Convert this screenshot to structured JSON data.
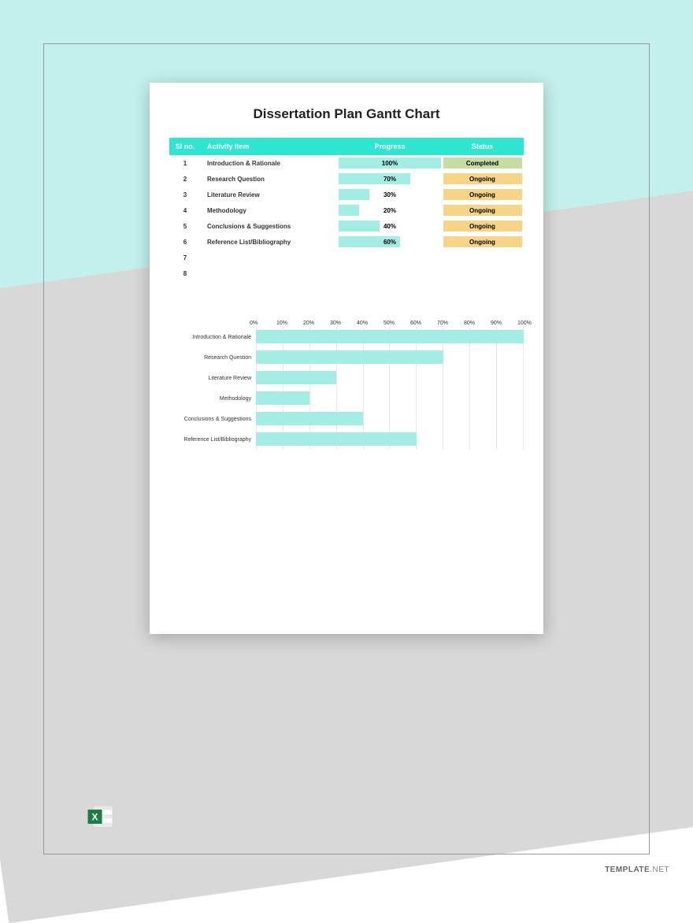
{
  "title": "Dissertation Plan Gantt Chart",
  "headers": {
    "sl": "Sl no.",
    "activity": "Activity Item",
    "progress": "Progress",
    "status": "Status"
  },
  "rows": [
    {
      "sl": "1",
      "activity": "Introduction & Rationale",
      "progress": 100,
      "progress_label": "100%",
      "status": "Completed",
      "status_class": "completed"
    },
    {
      "sl": "2",
      "activity": "Research Question",
      "progress": 70,
      "progress_label": "70%",
      "status": "Ongoing",
      "status_class": "ongoing"
    },
    {
      "sl": "3",
      "activity": "Literature Review",
      "progress": 30,
      "progress_label": "30%",
      "status": "Ongoing",
      "status_class": "ongoing"
    },
    {
      "sl": "4",
      "activity": "Methodology",
      "progress": 20,
      "progress_label": "20%",
      "status": "Ongoing",
      "status_class": "ongoing"
    },
    {
      "sl": "5",
      "activity": "Conclusions & Suggestions",
      "progress": 40,
      "progress_label": "40%",
      "status": "Ongoing",
      "status_class": "ongoing"
    },
    {
      "sl": "6",
      "activity": "Reference List/Bibliography",
      "progress": 60,
      "progress_label": "60%",
      "status": "Ongoing",
      "status_class": "ongoing"
    },
    {
      "sl": "7",
      "activity": "",
      "progress": null,
      "progress_label": "",
      "status": "",
      "status_class": ""
    },
    {
      "sl": "8",
      "activity": "",
      "progress": null,
      "progress_label": "",
      "status": "",
      "status_class": ""
    }
  ],
  "chart_data": {
    "type": "bar",
    "title": "",
    "xlabel": "",
    "ylabel": "",
    "xlim": [
      0,
      100
    ],
    "ticks": [
      "0%",
      "10%",
      "20%",
      "30%",
      "40%",
      "50%",
      "60%",
      "70%",
      "80%",
      "90%",
      "100%"
    ],
    "categories": [
      "Introduction & Rationale",
      "Research Question",
      "Literature Review",
      "Methodology",
      "Conclusions & Suggestions",
      "Reference List/Bibliography"
    ],
    "values": [
      100,
      70,
      30,
      20,
      40,
      60
    ]
  },
  "watermark": {
    "brand": "TEMPLATE",
    "tld": ".NET"
  },
  "icon_label": "excel-icon"
}
